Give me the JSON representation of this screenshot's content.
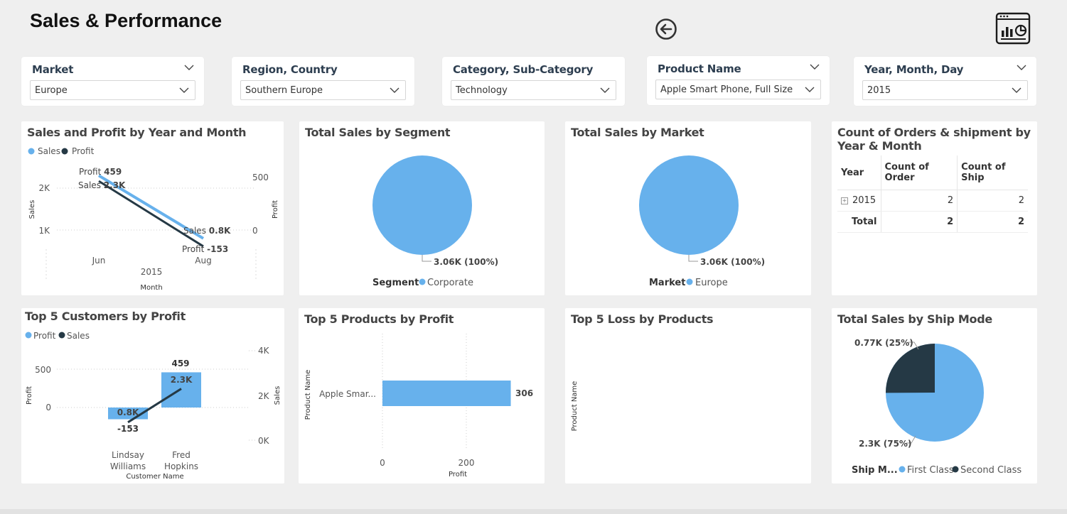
{
  "header": {
    "title": "Sales & Performance",
    "back_icon": "back-arrow-icon",
    "report_icon": "report-page-icon"
  },
  "slicers": [
    {
      "title": "Market",
      "value": "Europe",
      "has_header_chevron": true
    },
    {
      "title": "Region, Country",
      "value": "Southern Europe",
      "has_header_chevron": false
    },
    {
      "title": "Category, Sub-Category",
      "value": "Technology",
      "has_header_chevron": false
    },
    {
      "title": "Product Name",
      "value": "Apple Smart Phone, Full Size",
      "has_header_chevron": true
    },
    {
      "title": "Year, Month, Day",
      "value": "2015",
      "has_header_chevron": true
    }
  ],
  "colors": {
    "light_blue": "#67b1ec",
    "dark": "#253945"
  },
  "sales_profit_chart": {
    "title": "Sales and Profit by Year and Month",
    "legend": [
      "Sales",
      "Profit"
    ],
    "y_left_label": "Sales",
    "y_right_label": "Profit",
    "x_label": "Month",
    "year_label": "2015",
    "left_ticks": [
      "2K",
      "1K"
    ],
    "right_ticks": [
      "500",
      "0"
    ],
    "labels": {
      "profit_start_name": "Profit",
      "profit_start_value": "459",
      "sales_start_name": "Sales",
      "sales_start_value": "2.3K",
      "sales_end_name": "Sales",
      "sales_end_value": "0.8K",
      "profit_end_name": "Profit",
      "profit_end_value": "-153"
    }
  },
  "segment_chart": {
    "title": "Total Sales by Segment",
    "label": "3.06K (100%)",
    "legend_title": "Segment",
    "legend_item": "Corporate"
  },
  "market_chart": {
    "title": "Total Sales by Market",
    "label": "3.06K (100%)",
    "legend_title": "Market",
    "legend_item": "Europe"
  },
  "orders_table": {
    "title": "Count of Orders & shipment by Year & Month",
    "headers": [
      "Year",
      "Count of Order",
      "Count of Ship"
    ],
    "row": {
      "year": "2015",
      "orders": "2",
      "ship": "2"
    },
    "total": {
      "label": "Total",
      "orders": "2",
      "ship": "2"
    }
  },
  "customers_chart": {
    "title": "Top 5 Customers by Profit",
    "legend": [
      "Profit",
      "Sales"
    ],
    "y_left_label": "Profit",
    "y_right_label": "Sales",
    "x_label": "Customer Name",
    "left_ticks": [
      "500",
      "0"
    ],
    "right_ticks": [
      "4K",
      "2K",
      "0K"
    ],
    "customers": [
      {
        "name_line1": "Lindsay",
        "name_line2": "Williams",
        "profit_label": "-153",
        "sales_label": "0.8K"
      },
      {
        "name_line1": "Fred",
        "name_line2": "Hopkins",
        "profit_label": "459",
        "sales_label": "2.3K"
      }
    ]
  },
  "products_chart": {
    "title": "Top 5 Products by Profit",
    "y_label": "Product Name",
    "x_label": "Profit",
    "ticks": [
      "0",
      "200"
    ],
    "bar_label": "Apple Smar...",
    "bar_value_label": "306"
  },
  "loss_chart": {
    "title": "Top 5 Loss by Products",
    "y_label": "Product Name"
  },
  "shipmode_chart": {
    "title": "Total Sales by Ship Mode",
    "label_dark": "0.77K (25%)",
    "label_light": "2.3K (75%)",
    "legend_title": "Ship M...",
    "legend_items": [
      "First Class",
      "Second Class"
    ]
  },
  "chart_data": [
    {
      "type": "line",
      "title": "Sales and Profit by Year and Month",
      "x": [
        "Jun",
        "Aug"
      ],
      "series": [
        {
          "name": "Sales",
          "values": [
            2300,
            800
          ]
        },
        {
          "name": "Profit",
          "values": [
            459,
            -153
          ]
        }
      ],
      "xlabel": "Month",
      "ylabel": "Sales",
      "y2label": "Profit"
    },
    {
      "type": "pie",
      "title": "Total Sales by Segment",
      "categories": [
        "Corporate"
      ],
      "values": [
        3060
      ]
    },
    {
      "type": "pie",
      "title": "Total Sales by Market",
      "categories": [
        "Europe"
      ],
      "values": [
        3060
      ]
    },
    {
      "type": "bar",
      "title": "Top 5 Customers by Profit",
      "categories": [
        "Lindsay Williams",
        "Fred Hopkins"
      ],
      "series": [
        {
          "name": "Profit",
          "values": [
            -153,
            459
          ]
        },
        {
          "name": "Sales",
          "values": [
            800,
            2300
          ]
        }
      ],
      "xlabel": "Customer Name",
      "ylabel": "Profit",
      "y2label": "Sales"
    },
    {
      "type": "bar",
      "title": "Top 5 Products by Profit",
      "categories": [
        "Apple Smar..."
      ],
      "values": [
        306
      ],
      "xlabel": "Profit",
      "ylabel": "Product Name"
    },
    {
      "type": "pie",
      "title": "Total Sales by Ship Mode",
      "categories": [
        "First Class",
        "Second Class"
      ],
      "values": [
        2300,
        770
      ]
    }
  ]
}
